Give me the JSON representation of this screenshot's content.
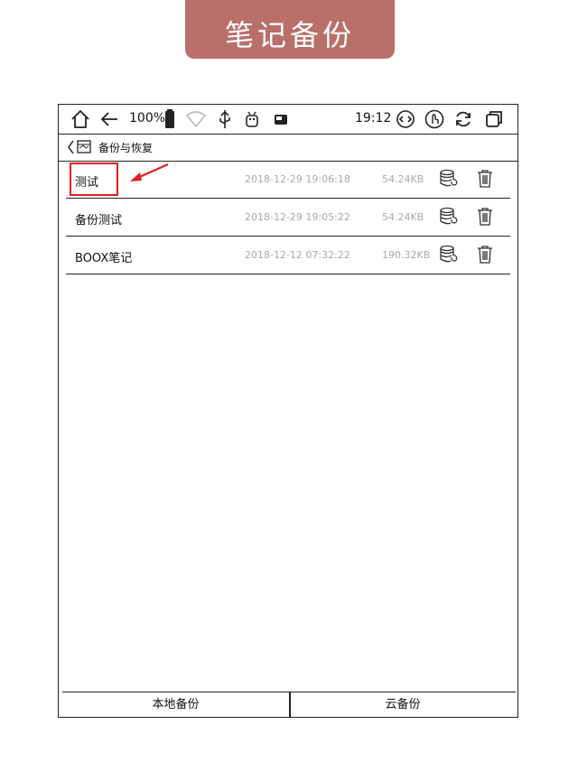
{
  "banner": {
    "title": "笔记备份"
  },
  "status_bar": {
    "battery": "100%",
    "time": "19:12"
  },
  "nav": {
    "title": "备份与恢复"
  },
  "backups": [
    {
      "name": "测试",
      "date": "2018-12-29 19:06:18",
      "size": "54.24KB"
    },
    {
      "name": "备份测试",
      "date": "2018-12-29 19:05:22",
      "size": "54.24KB"
    },
    {
      "name": "BOOX笔记",
      "date": "2018-12-12 07:32:22",
      "size": "190.32KB"
    }
  ],
  "tabs": {
    "local": "本地备份",
    "cloud": "云备份"
  },
  "colors": {
    "banner": "#b9706a",
    "highlight": "#e02020"
  }
}
